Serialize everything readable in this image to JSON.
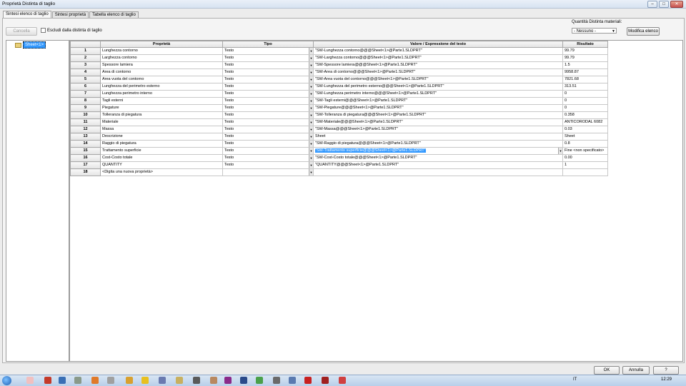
{
  "window": {
    "title": "Proprietà Distinta di taglio",
    "controls": [
      "–",
      "□",
      "✕"
    ]
  },
  "tabs": [
    {
      "label": "Sintesi elenco di taglio",
      "active": true
    },
    {
      "label": "Sintesi proprietà",
      "active": false
    },
    {
      "label": "Tabella elenco di taglio",
      "active": false
    }
  ],
  "toolbar": {
    "cancel_label": "Cancella",
    "exclude_label": "Escludi dalla distinta di taglio",
    "exclude_checked": false,
    "qty_label": "Quantità Distinta materiali:",
    "qty_value": "- Nessuno -",
    "modify_label": "Modifica elenco"
  },
  "tree": {
    "item_label": "Sheet<1>",
    "icon": "folder-icon"
  },
  "table": {
    "headers": [
      "",
      "Proprietà",
      "Tipo",
      "Valore / Espressione del testo",
      "Risultato"
    ],
    "rows": [
      {
        "n": "1",
        "prop": "Lunghezza contorno",
        "type": "Testo",
        "value": "\"SW-Lunghezza contorno@@@Sheet<1>@Parte1.SLDPRT\"",
        "result": "99.79"
      },
      {
        "n": "2",
        "prop": "Larghezza contorno",
        "type": "Testo",
        "value": "\"SW-Larghezza contorno@@@Sheet<1>@Parte1.SLDPRT\"",
        "result": "99.79"
      },
      {
        "n": "3",
        "prop": "Spessore lamiera",
        "type": "Testo",
        "value": "\"SW-Spessore lamiera@@@Sheet<1>@Parte1.SLDPRT\"",
        "result": "1.5"
      },
      {
        "n": "4",
        "prop": "Area di contorno",
        "type": "Testo",
        "value": "\"SW-Area di contorno@@@Sheet<1>@Parte1.SLDPRT\"",
        "result": "9958.87"
      },
      {
        "n": "5",
        "prop": "Area vuota del contorno",
        "type": "Testo",
        "value": "\"SW-Area vuota del contorno@@@Sheet<1>@Parte1.SLDPRT\"",
        "result": "7821.68"
      },
      {
        "n": "6",
        "prop": "Lunghezza del perimetro esterno",
        "type": "Testo",
        "value": "\"SW-Lunghezza del perimetro esterno@@@Sheet<1>@Parte1.SLDPRT\"",
        "result": "313.51"
      },
      {
        "n": "7",
        "prop": "Lunghezza perimetro interno",
        "type": "Testo",
        "value": "\"SW-Lunghezza perimetro interno@@@Sheet<1>@Parte1.SLDPRT\"",
        "result": "0"
      },
      {
        "n": "8",
        "prop": "Tagli esterni",
        "type": "Testo",
        "value": "\"SW-Tagli esterni@@@Sheet<1>@Parte1.SLDPRT\"",
        "result": "0"
      },
      {
        "n": "9",
        "prop": "Piegature",
        "type": "Testo",
        "value": "\"SW-Piegature@@@Sheet<1>@Parte1.SLDPRT\"",
        "result": "0"
      },
      {
        "n": "10",
        "prop": "Tolleranza di piegatura",
        "type": "Testo",
        "value": "\"SW-Tolleranza di piegatura@@@Sheet<1>@Parte1.SLDPRT\"",
        "result": "0.358"
      },
      {
        "n": "11",
        "prop": "Materiale",
        "type": "Testo",
        "value": "\"SW-Materiale@@@Sheet<1>@Parte1.SLDPRT\"",
        "result": "ANTICORODAL 6082"
      },
      {
        "n": "12",
        "prop": "Massa",
        "type": "Testo",
        "value": "\"SW-Massa@@@Sheet<1>@Parte1.SLDPRT\"",
        "result": "0.03"
      },
      {
        "n": "13",
        "prop": "Descrizione",
        "type": "Testo",
        "value": "Sheet",
        "result": "Sheet"
      },
      {
        "n": "14",
        "prop": "Raggio di piegatura",
        "type": "Testo",
        "value": "\"SW-Raggio di piegatura@@@Sheet<1>@Parte1.SLDPRT\"",
        "result": "0.8"
      },
      {
        "n": "15",
        "prop": "Trattamento superficie",
        "type": "Testo",
        "value": "\"SW-Trattamento superficie@@@Sheet<1>@Parte1.SLDPRT\"",
        "result": "Fine <non specificato>",
        "selected": true
      },
      {
        "n": "16",
        "prop": "Cost-Costo totale",
        "type": "Testo",
        "value": "\"SW-Cost-Costo totale@@@Sheet<1>@Parte1.SLDPRT\"",
        "result": "0.00"
      },
      {
        "n": "17",
        "prop": "QUANTITY",
        "type": "Testo",
        "value": "\"QUANTITY@@@Sheet<1>@Parte1.SLDPRT\"",
        "result": "1"
      },
      {
        "n": "18",
        "prop": "<Digita una nuova proprietà>",
        "type": "",
        "value": "",
        "result": ""
      }
    ]
  },
  "footer": {
    "ok_label": "OK",
    "annulla_label": "Annulla",
    "help_label": "?"
  },
  "taskbar": {
    "lang": "IT",
    "time": "12:29"
  }
}
